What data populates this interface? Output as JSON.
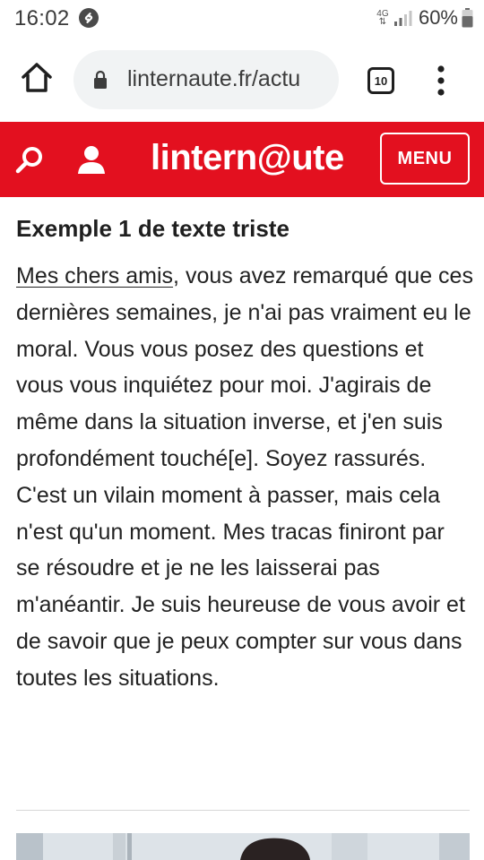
{
  "status_bar": {
    "time": "16:02",
    "network": "4G",
    "battery_percent": "60%",
    "app_icon": "shazam-icon"
  },
  "browser": {
    "url": "linternaute.fr/actu",
    "tab_count": "10",
    "icons": [
      "home-icon",
      "lock-icon",
      "more-vert-icon"
    ]
  },
  "site_header": {
    "logo": "lintern@ute",
    "menu_label": "MENU",
    "background": "#e3101f",
    "icons": [
      "search-icon",
      "user-icon"
    ]
  },
  "article": {
    "heading": "Exemple 1 de texte triste",
    "link_text": "Mes chers amis",
    "body_text": ", vous avez remarqué que ces dernières semaines, je n'ai pas vraiment eu le moral. Vous vous posez des questions et vous vous inquiétez pour moi. J'agirais de même dans la situation inverse, et j'en suis profondément touché[e]. Soyez rassurés. C'est un vilain moment à passer, mais cela n'est qu'un moment. Mes tracas finiront par se résoudre et je ne les laisserai pas m'anéantir. Je suis heureuse de vous avoir et de savoir que je peux compter sur vous dans toutes les situations."
  }
}
